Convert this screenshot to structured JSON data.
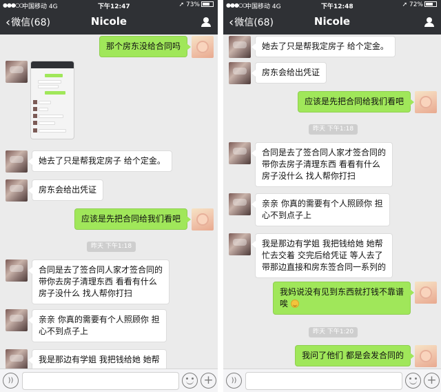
{
  "colors": {
    "nav_bg": "#2f3135",
    "outgoing_bubble": "#a0e75a",
    "incoming_bubble": "#ffffff",
    "chat_bg": "#ebebeb"
  },
  "left": {
    "status": {
      "signal": "●●●○○",
      "carrier": "中国移动 4G",
      "time": "下午12:47",
      "battery": "73%",
      "battery_level": 0.73
    },
    "nav": {
      "back_label": "微信(68)",
      "title": "Nicole"
    },
    "messages": {
      "m1": "那个房东没给合同吗",
      "m3": "她去了只是帮我定房子 给个定金。",
      "m4": "房东会给出凭证",
      "m5": "应该是先把合同给我们看吧",
      "time1": "昨天 下午1:18",
      "m6": "合同是去了签合同人家才签合同的\n带你去房子清理东西 看看有什么\n房子没什么 找人帮你打扫",
      "m7": "亲亲 你真的需要有个人照顾你 担\n心不到点子上",
      "m8": "我是那边有学姐 我把钱给她 她帮"
    }
  },
  "right": {
    "status": {
      "signal": "●●●○○",
      "carrier": "中国移动 4G",
      "time": "下午12:48",
      "battery": "72%",
      "battery_level": 0.72
    },
    "nav": {
      "back_label": "微信(68)",
      "title": "Nicole"
    },
    "messages": {
      "m1": "她去了只是帮我定房子 给个定金。",
      "m2": "房东会给出凭证",
      "m3": "应该是先把合同给我们看吧",
      "time1": "昨天 下午1:18",
      "m4": "合同是去了签合同人家才签合同的\n带你去房子清理东西 看看有什么\n房子没什么 找人帮你打扫",
      "m5": "亲亲 你真的需要有个人照顾你 担\n心不到点子上",
      "m6": "我是那边有学姐 我把钱给她 她帮\n忙去交着 交完后给凭证 等人去了\n带那边直接和房东签合同一系列的",
      "m7": "我妈说没有见到东西就打钱不靠谱\n唉",
      "time2": "昨天 下午1:20",
      "m8": "我问了他们 都是会发合同的"
    }
  },
  "icons": {
    "back": "chevron-left-icon",
    "profile": "person-icon",
    "voice": "voice-icon",
    "emoji": "emoji-icon",
    "plus": "plus-icon"
  }
}
